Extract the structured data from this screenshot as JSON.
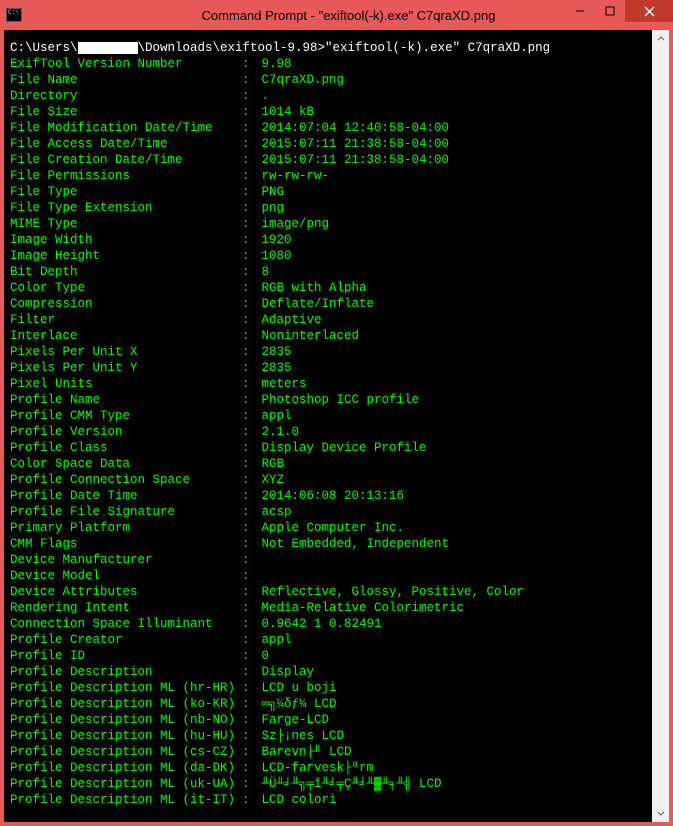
{
  "window": {
    "title": "Command Prompt - \"exiftool(-k).exe\"  C7qraXD.png"
  },
  "prompt": {
    "prefix": "C:\\Users\\",
    "suffix": "\\Downloads\\exiftool-9.98>\"exiftool(-k).exe\" C7qraXD.png"
  },
  "rows": [
    {
      "k": "ExifTool Version Number",
      "v": "9.98"
    },
    {
      "k": "File Name",
      "v": "C7qraXD.png"
    },
    {
      "k": "Directory",
      "v": "."
    },
    {
      "k": "File Size",
      "v": "1014 kB"
    },
    {
      "k": "File Modification Date/Time",
      "v": "2014:07:04 12:40:58-04:00"
    },
    {
      "k": "File Access Date/Time",
      "v": "2015:07:11 21:38:58-04:00"
    },
    {
      "k": "File Creation Date/Time",
      "v": "2015:07:11 21:38:58-04:00"
    },
    {
      "k": "File Permissions",
      "v": "rw-rw-rw-"
    },
    {
      "k": "File Type",
      "v": "PNG"
    },
    {
      "k": "File Type Extension",
      "v": "png"
    },
    {
      "k": "MIME Type",
      "v": "image/png"
    },
    {
      "k": "Image Width",
      "v": "1920"
    },
    {
      "k": "Image Height",
      "v": "1080"
    },
    {
      "k": "Bit Depth",
      "v": "8"
    },
    {
      "k": "Color Type",
      "v": "RGB with Alpha"
    },
    {
      "k": "Compression",
      "v": "Deflate/Inflate"
    },
    {
      "k": "Filter",
      "v": "Adaptive"
    },
    {
      "k": "Interlace",
      "v": "Noninterlaced"
    },
    {
      "k": "Pixels Per Unit X",
      "v": "2835"
    },
    {
      "k": "Pixels Per Unit Y",
      "v": "2835"
    },
    {
      "k": "Pixel Units",
      "v": "meters"
    },
    {
      "k": "Profile Name",
      "v": "Photoshop ICC profile"
    },
    {
      "k": "Profile CMM Type",
      "v": "appl"
    },
    {
      "k": "Profile Version",
      "v": "2.1.0"
    },
    {
      "k": "Profile Class",
      "v": "Display Device Profile"
    },
    {
      "k": "Color Space Data",
      "v": "RGB"
    },
    {
      "k": "Profile Connection Space",
      "v": "XYZ"
    },
    {
      "k": "Profile Date Time",
      "v": "2014:06:08 20:13:16"
    },
    {
      "k": "Profile File Signature",
      "v": "acsp"
    },
    {
      "k": "Primary Platform",
      "v": "Apple Computer Inc."
    },
    {
      "k": "CMM Flags",
      "v": "Not Embedded, Independent"
    },
    {
      "k": "Device Manufacturer",
      "v": ""
    },
    {
      "k": "Device Model",
      "v": ""
    },
    {
      "k": "Device Attributes",
      "v": "Reflective, Glossy, Positive, Color"
    },
    {
      "k": "Rendering Intent",
      "v": "Media-Relative Colorimetric"
    },
    {
      "k": "Connection Space Illuminant",
      "v": "0.9642 1 0.82491"
    },
    {
      "k": "Profile Creator",
      "v": "appl"
    },
    {
      "k": "Profile ID",
      "v": "0"
    },
    {
      "k": "Profile Description",
      "v": "Display"
    },
    {
      "k": "Profile Description ML (hr-HR)",
      "v": "LCD u boji"
    },
    {
      "k": "Profile Description ML (ko-KR)",
      "v": "∞╗¼δƒ¼ LCD"
    },
    {
      "k": "Profile Description ML (nb-NO)",
      "v": "Farge-LCD"
    },
    {
      "k": "Profile Description ML (hu-HU)",
      "v": "Sz├¡nes LCD"
    },
    {
      "k": "Profile Description ML (cs-CZ)",
      "v": "Barevn├╜ LCD"
    },
    {
      "k": "Profile Description ML (da-DK)",
      "v": "LCD-farvesk├ªrm"
    },
    {
      "k": "Profile Description ML (uk-UA)",
      "v": "╨Ü╨╛╨╗╤î╨╛╤Ç╨╛╨▓╨╕╨╣ LCD"
    },
    {
      "k": "Profile Description ML (it-IT)",
      "v": "LCD colori"
    }
  ]
}
